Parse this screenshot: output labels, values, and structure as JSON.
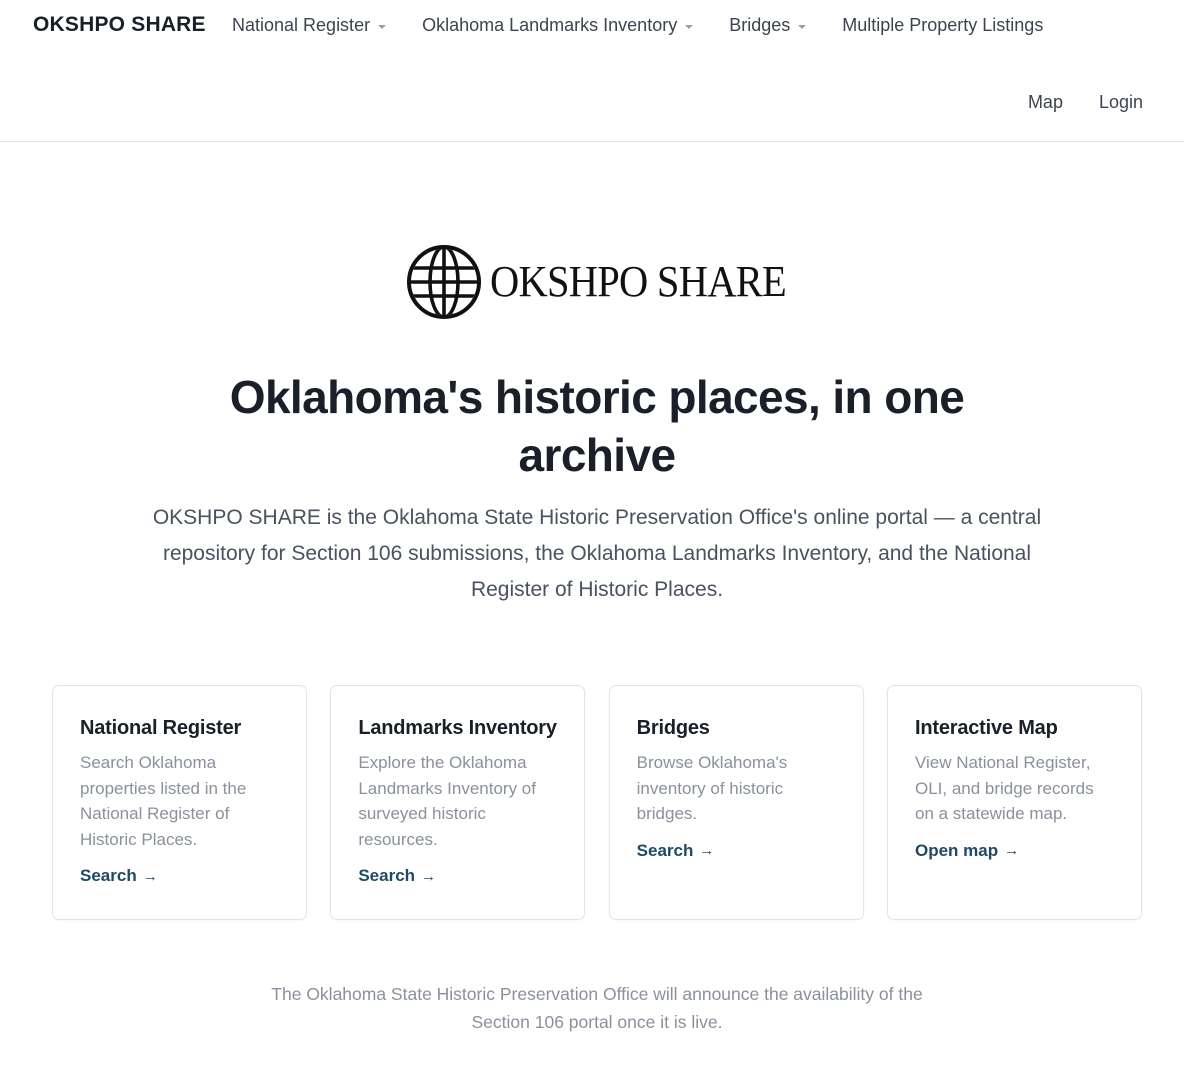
{
  "header": {
    "brand": "OKSHPO SHARE",
    "nav": [
      {
        "label": "National Register",
        "dropdown": true
      },
      {
        "label": "Oklahoma Landmarks Inventory",
        "dropdown": true
      },
      {
        "label": "Bridges",
        "dropdown": true
      },
      {
        "label": "Multiple Property Listings",
        "dropdown": false
      }
    ],
    "nav_right": [
      {
        "label": "Map"
      },
      {
        "label": "Login"
      }
    ]
  },
  "hero": {
    "logo_text": "OKSHPO SHARE",
    "logo_icon": "globe-icon",
    "headline": "Oklahoma's historic places, in one archive",
    "lead": "OKSHPO SHARE is the Oklahoma State Historic Preservation Office's online portal — a central repository for Section 106 submissions, the Oklahoma Landmarks Inventory, and the National Register of Historic Places."
  },
  "cards": [
    {
      "title": "National Register",
      "description": "Search Oklahoma properties listed in the National Register of Historic Places.",
      "link": "Search",
      "arrow": "→"
    },
    {
      "title": "Landmarks Inventory",
      "description": "Explore the Oklahoma Landmarks Inventory of surveyed historic resources.",
      "link": "Search",
      "arrow": "→"
    },
    {
      "title": "Bridges",
      "description": "Browse Oklahoma's inventory of historic bridges.",
      "link": "Search",
      "arrow": "→"
    },
    {
      "title": "Interactive Map",
      "description": "View National Register, OLI, and bridge records on a statewide map.",
      "link": "Open map",
      "arrow": "→"
    }
  ],
  "footer_note": "The Oklahoma State Historic Preservation Office will announce the availability of the Section 106 portal once it is live.",
  "colors": {
    "text_primary": "#1a1f29",
    "text_muted": "#8a919c",
    "link": "#1e4a67",
    "border": "#e1e4e8"
  }
}
